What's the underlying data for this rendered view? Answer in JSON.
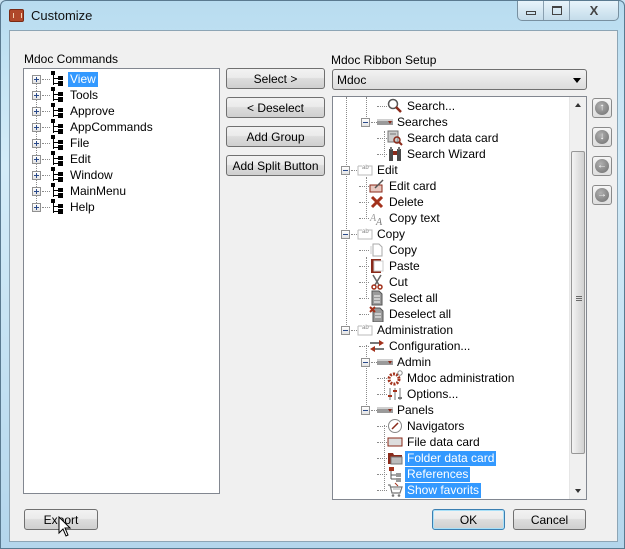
{
  "window": {
    "title": "Customize",
    "caption_buttons": {
      "minimize": "▭",
      "maximize": "◻",
      "close": "X"
    }
  },
  "left_panel": {
    "label": "Mdoc Commands",
    "items": [
      {
        "label": "View",
        "selected": true
      },
      {
        "label": "Tools",
        "selected": false
      },
      {
        "label": "Approve",
        "selected": false
      },
      {
        "label": "AppCommands",
        "selected": false
      },
      {
        "label": "File",
        "selected": false
      },
      {
        "label": "Edit",
        "selected": false
      },
      {
        "label": "Window",
        "selected": false
      },
      {
        "label": "MainMenu",
        "selected": false
      },
      {
        "label": "Help",
        "selected": false
      }
    ]
  },
  "middle_buttons": {
    "select": "Select >",
    "deselect": "< Deselect",
    "add_group": "Add Group",
    "add_split_button": "Add Split Button"
  },
  "right_panel": {
    "label": "Mdoc Ribbon Setup",
    "combo_value": "Mdoc",
    "tree": [
      {
        "label": "Search...",
        "icon": "magnifier-icon",
        "level": 2
      },
      {
        "label": "Searches",
        "icon": "split-button-icon",
        "level": 1,
        "expanded": true
      },
      {
        "label": "Search data card",
        "icon": "search-card-icon",
        "level": 2
      },
      {
        "label": "Search Wizard",
        "icon": "binoculars-icon",
        "level": 2
      },
      {
        "label": "Edit",
        "icon": "group-icon",
        "level": 0,
        "expanded": true
      },
      {
        "label": "Edit card",
        "icon": "edit-card-icon",
        "level": 1
      },
      {
        "label": "Delete",
        "icon": "delete-icon",
        "level": 1
      },
      {
        "label": "Copy text",
        "icon": "copy-text-icon",
        "level": 1
      },
      {
        "label": "Copy",
        "icon": "group-icon",
        "level": 0,
        "expanded": true
      },
      {
        "label": "Copy",
        "icon": "copy-icon",
        "level": 1
      },
      {
        "label": "Paste",
        "icon": "paste-icon",
        "level": 1
      },
      {
        "label": "Cut",
        "icon": "scissors-icon",
        "level": 1
      },
      {
        "label": "Select all",
        "icon": "select-all-icon",
        "level": 1
      },
      {
        "label": "Deselect all",
        "icon": "deselect-all-icon",
        "level": 1
      },
      {
        "label": "Administration",
        "icon": "group-icon",
        "level": 0,
        "expanded": true
      },
      {
        "label": "Configuration...",
        "icon": "configuration-icon",
        "level": 1
      },
      {
        "label": "Admin",
        "icon": "split-button-icon",
        "level": 1,
        "expanded": true
      },
      {
        "label": "Mdoc administration",
        "icon": "gear-icon",
        "level": 2
      },
      {
        "label": "Options...",
        "icon": "options-icon",
        "level": 2
      },
      {
        "label": "Panels",
        "icon": "split-button-icon",
        "level": 1,
        "expanded": true
      },
      {
        "label": "Navigators",
        "icon": "compass-icon",
        "level": 2
      },
      {
        "label": "File data card",
        "icon": "file-card-icon",
        "level": 2
      },
      {
        "label": "Folder data card",
        "icon": "folder-card-icon",
        "level": 2,
        "selected": true
      },
      {
        "label": "References",
        "icon": "references-icon",
        "level": 2,
        "selected": true
      },
      {
        "label": "Show favorits",
        "icon": "cart-icon",
        "level": 2,
        "selected": true
      }
    ],
    "scroll_position": 0.55
  },
  "move_buttons": {
    "up": "↑",
    "down": "↓",
    "left": "←",
    "right": "→"
  },
  "footer": {
    "export": "Export",
    "ok": "OK",
    "cancel": "Cancel"
  }
}
